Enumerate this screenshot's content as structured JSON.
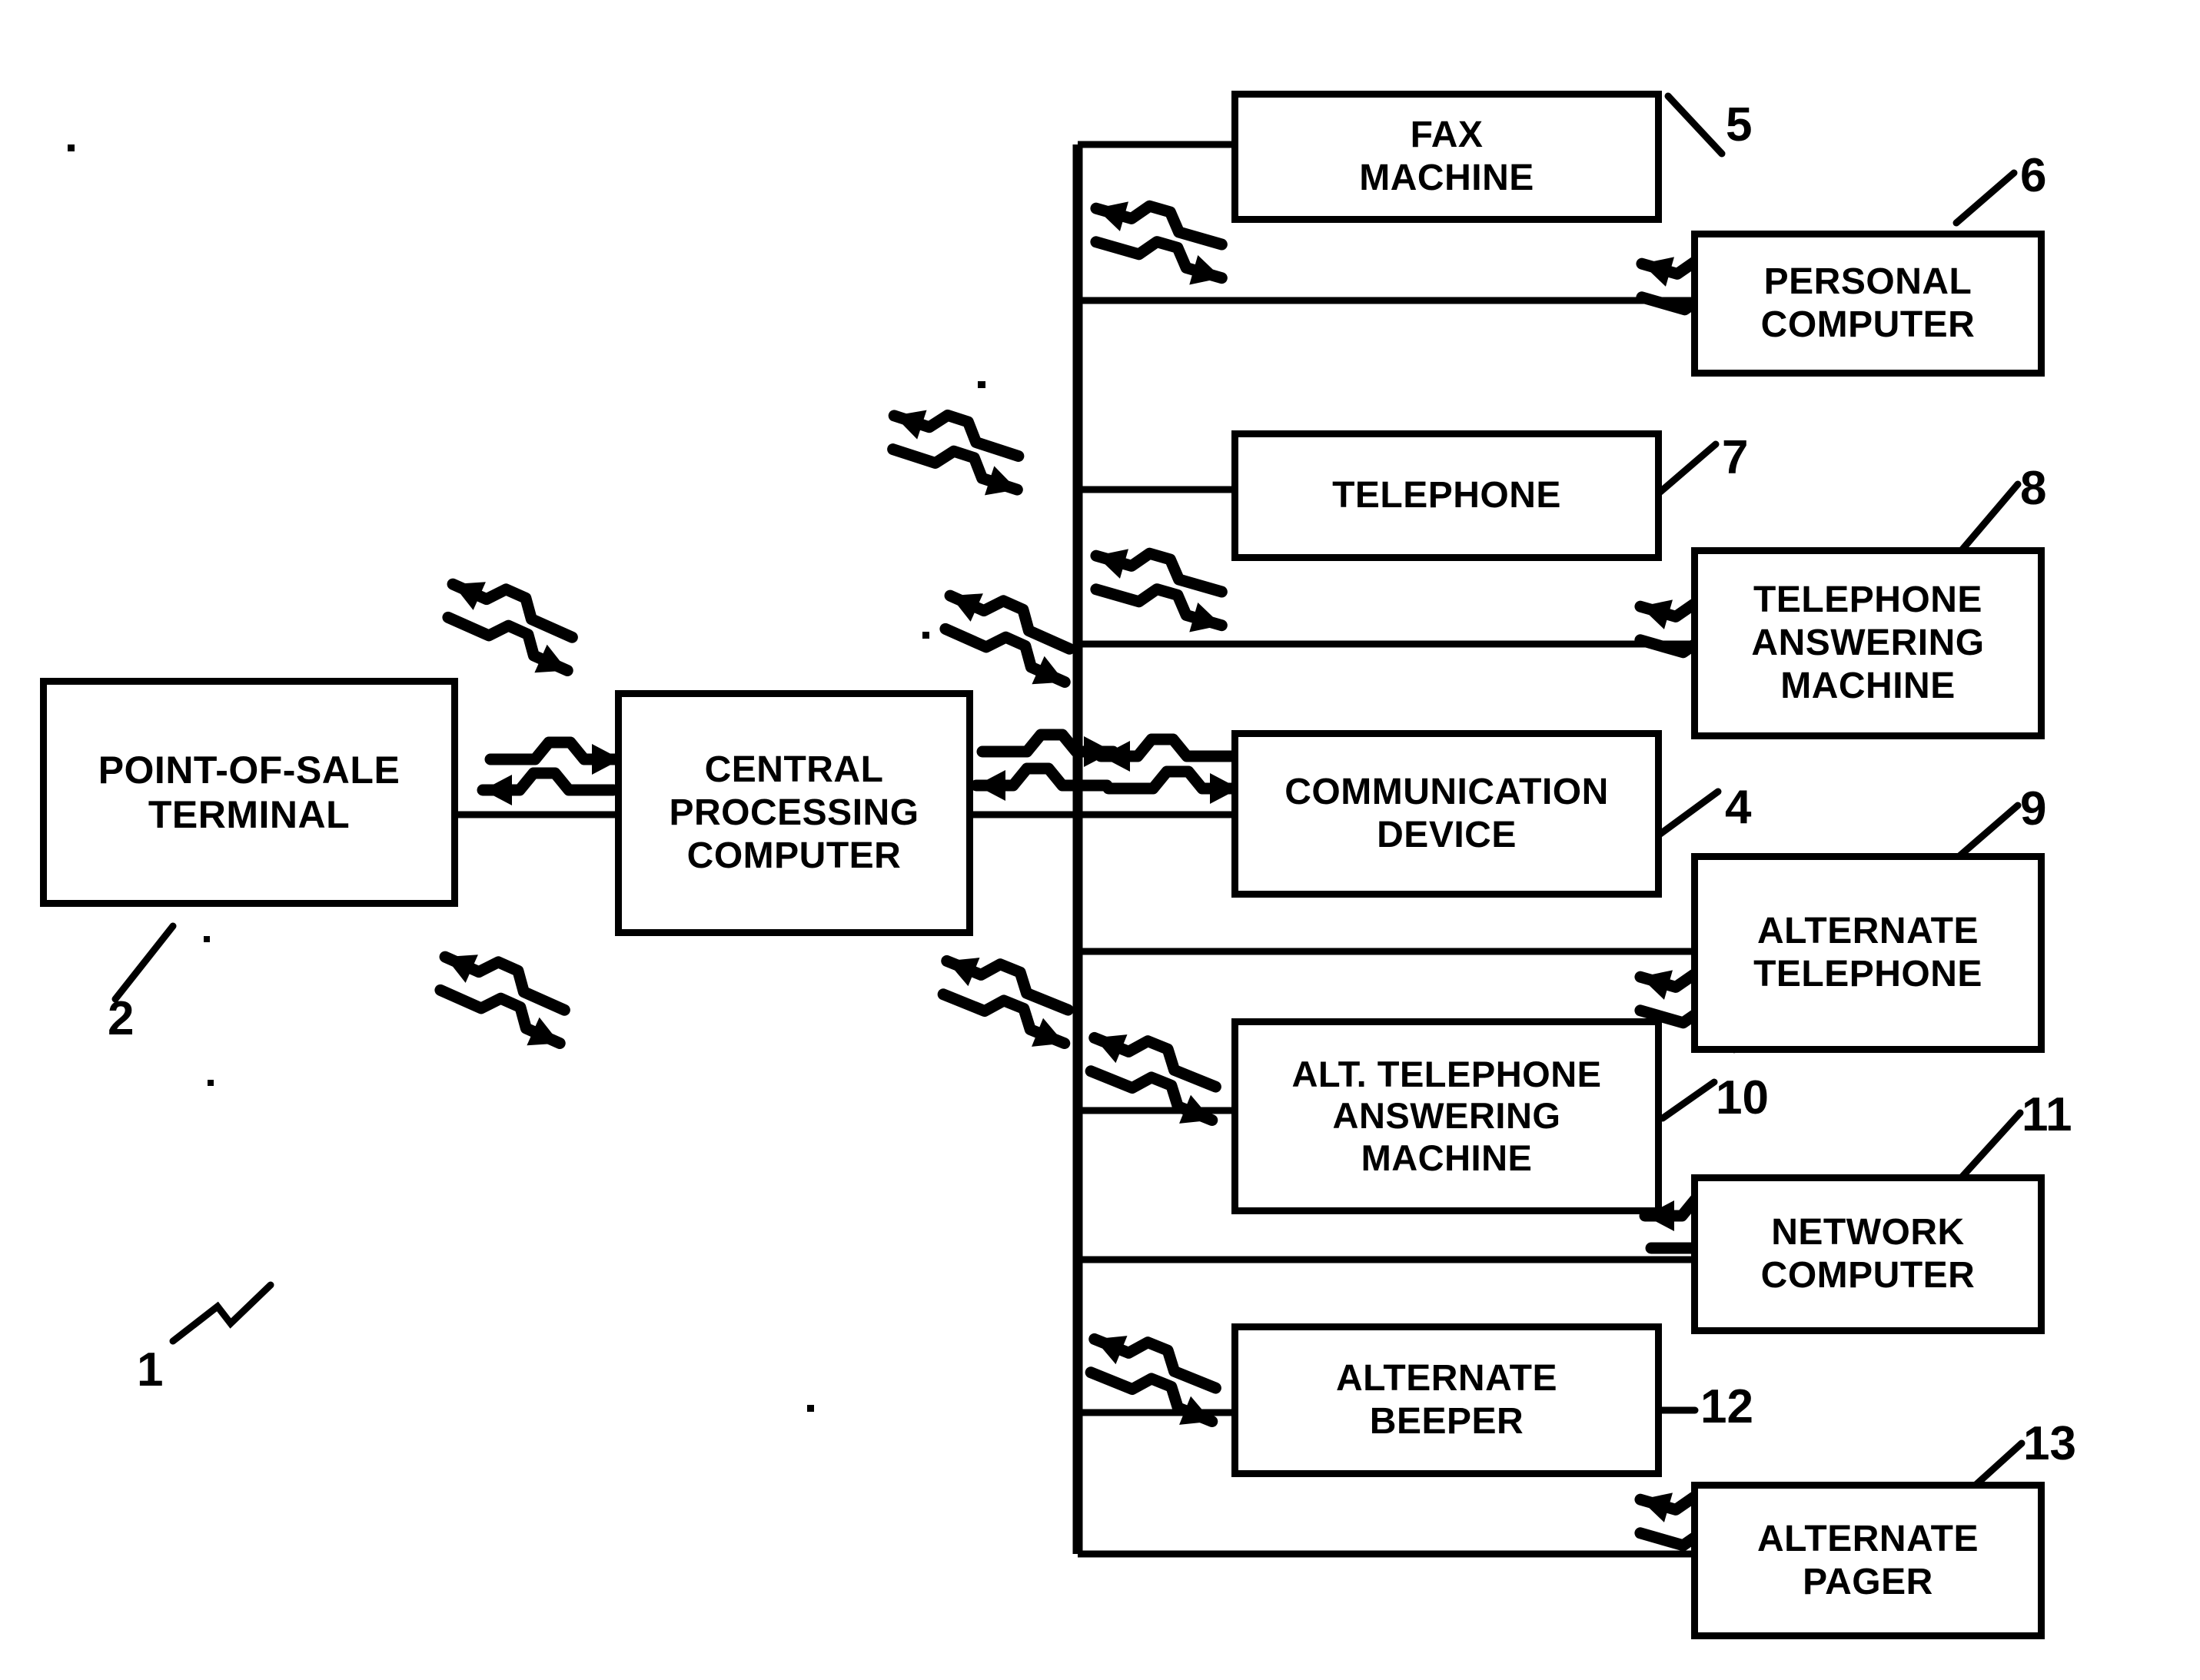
{
  "figure": {
    "kind": "patent-block-diagram",
    "system_reference": "1",
    "line_color": "#000000",
    "background_color": "#ffffff"
  },
  "nodes": [
    {
      "id": "pos",
      "label": "POINT-OF-SALE\nTERMINAL",
      "line1": "POINT-OF-SALE",
      "line2": "TERMINAL",
      "line3": "",
      "ref": "2"
    },
    {
      "id": "cpc",
      "label": "CENTRAL\nPROCESSING\nCOMPUTER",
      "line1": "CENTRAL",
      "line2": "PROCESSING",
      "line3": "COMPUTER",
      "ref": ""
    },
    {
      "id": "fax",
      "label": "FAX\nMACHINE",
      "line1": "FAX",
      "line2": "MACHINE",
      "line3": "",
      "ref": "5"
    },
    {
      "id": "pc",
      "label": "PERSONAL\nCOMPUTER",
      "line1": "PERSONAL",
      "line2": "COMPUTER",
      "line3": "",
      "ref": "6"
    },
    {
      "id": "tel",
      "label": "TELEPHONE",
      "line1": "TELEPHONE",
      "line2": "",
      "line3": "",
      "ref": "7"
    },
    {
      "id": "tam",
      "label": "TELEPHONE\nANSWERING\nMACHINE",
      "line1": "TELEPHONE",
      "line2": "ANSWERING",
      "line3": "MACHINE",
      "ref": "8"
    },
    {
      "id": "comm",
      "label": "COMMUNICATION\nDEVICE",
      "line1": "COMMUNICATION",
      "line2": "DEVICE",
      "line3": "",
      "ref": "4"
    },
    {
      "id": "alttel",
      "label": "ALTERNATE\nTELEPHONE",
      "line1": "ALTERNATE",
      "line2": "TELEPHONE",
      "line3": "",
      "ref": "9"
    },
    {
      "id": "alttam",
      "label": "ALT. TELEPHONE\nANSWERING\nMACHINE",
      "line1": "ALT. TELEPHONE",
      "line2": "ANSWERING",
      "line3": "MACHINE",
      "ref": "10"
    },
    {
      "id": "netcomp",
      "label": "NETWORK\nCOMPUTER",
      "line1": "NETWORK",
      "line2": "COMPUTER",
      "line3": "",
      "ref": "11"
    },
    {
      "id": "altbeeper",
      "label": "ALTERNATE\nBEEPER",
      "line1": "ALTERNATE",
      "line2": "BEEPER",
      "line3": "",
      "ref": "12"
    },
    {
      "id": "altpager",
      "label": "ALTERNATE\nPAGER",
      "line1": "ALTERNATE",
      "line2": "PAGER",
      "line3": "",
      "ref": "13"
    }
  ],
  "reference_numerals": {
    "system": "1",
    "point_of_sale_terminal": "2",
    "communication_device": "4",
    "fax_machine": "5",
    "personal_computer": "6",
    "telephone": "7",
    "telephone_answering_machine": "8",
    "alternate_telephone": "9",
    "alt_telephone_answering_machine": "10",
    "network_computer": "11",
    "alternate_beeper": "12",
    "alternate_pager": "13"
  },
  "wireless_links": [
    {
      "from": "pos",
      "to": "cpc",
      "style": "bidirectional-zigzag-horizontal"
    },
    {
      "from": "cpc",
      "to": "bus",
      "style": "bidirectional-zigzag-horizontal"
    },
    {
      "from": "bus",
      "to": "comm",
      "style": "bidirectional-zigzag-horizontal"
    },
    {
      "from": "bus",
      "to": "fax",
      "style": "bidirectional-zigzag-diagonal"
    },
    {
      "from": "bus",
      "to": "pc",
      "style": "bidirectional-zigzag-diagonal"
    },
    {
      "from": "bus",
      "to": "tel",
      "style": "bidirectional-zigzag-diagonal"
    },
    {
      "from": "bus",
      "to": "tam",
      "style": "bidirectional-zigzag-diagonal"
    },
    {
      "from": "bus",
      "to": "alttel",
      "style": "bidirectional-zigzag-diagonal"
    },
    {
      "from": "bus",
      "to": "alttam",
      "style": "bidirectional-zigzag-diagonal"
    },
    {
      "from": "bus",
      "to": "netcomp",
      "style": "bidirectional-zigzag-diagonal"
    },
    {
      "from": "bus",
      "to": "altbeeper",
      "style": "bidirectional-zigzag-diagonal"
    },
    {
      "from": "bus",
      "to": "altpager",
      "style": "bidirectional-zigzag-diagonal"
    }
  ]
}
